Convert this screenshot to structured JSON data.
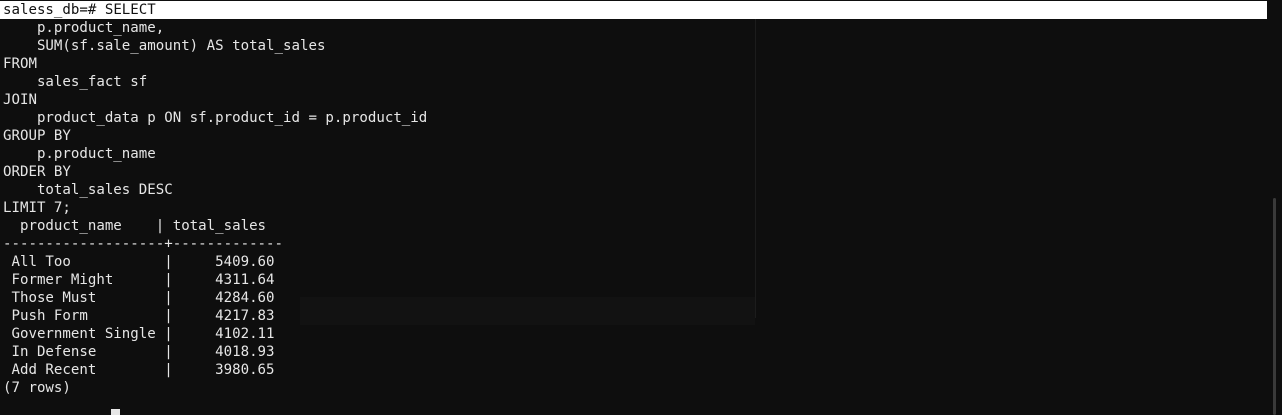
{
  "prompt": {
    "db_prompt": "saless_db=#",
    "command": " SELECT"
  },
  "query_lines": [
    "    p.product_name,",
    "    SUM(sf.sale_amount) AS total_sales",
    "FROM",
    "    sales_fact sf",
    "JOIN",
    "    product_data p ON sf.product_id = p.product_id",
    "GROUP BY",
    "    p.product_name",
    "ORDER BY",
    "    total_sales DESC",
    "LIMIT 7;"
  ],
  "result": {
    "header": "  product_name    | total_sales ",
    "separator": "-------------------+-------------",
    "columns": [
      "product_name",
      "total_sales"
    ],
    "rows": [
      {
        "product_name": "All Too",
        "total_sales": "5409.60"
      },
      {
        "product_name": "Former Might",
        "total_sales": "4311.64"
      },
      {
        "product_name": "Those Must",
        "total_sales": "4284.60"
      },
      {
        "product_name": "Push Form",
        "total_sales": "4217.83"
      },
      {
        "product_name": "Government Single",
        "total_sales": "4102.11"
      },
      {
        "product_name": "In Defense",
        "total_sales": "4018.93"
      },
      {
        "product_name": "Add Recent",
        "total_sales": "3980.65"
      }
    ],
    "row_lines": [
      " All Too           |     5409.60",
      " Former Might      |     4311.64",
      " Those Must        |     4284.60",
      " Push Form         |     4217.83",
      " Government Single |     4102.11",
      " In Defense        |     4018.93",
      " Add Recent        |     3980.65"
    ],
    "footer": "(7 rows)"
  },
  "colors": {
    "background": "#0e0e0e",
    "text": "#e6e6e6",
    "prompt_highlight": "#ffffff"
  }
}
